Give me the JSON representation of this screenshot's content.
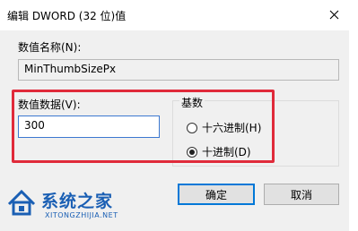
{
  "dialog": {
    "title": "编辑 DWORD (32 位)值",
    "close_glyph": "✕"
  },
  "name_section": {
    "label": "数值名称(N):",
    "value": "MinThumbSizePx"
  },
  "data_section": {
    "label": "数值数据(V):",
    "value": "300"
  },
  "base_section": {
    "label": "基数",
    "options": [
      {
        "label": "十六进制(H)",
        "selected": false
      },
      {
        "label": "十进制(D)",
        "selected": true
      }
    ]
  },
  "buttons": {
    "ok_label": "确定",
    "cancel_label": "取消"
  },
  "watermark": {
    "text": "系统之家",
    "url": "XITONGZHIJIA.NET"
  },
  "colors": {
    "highlight": "#e02a3a",
    "accent": "#0078d7",
    "watermark": "#1a5fb4"
  }
}
